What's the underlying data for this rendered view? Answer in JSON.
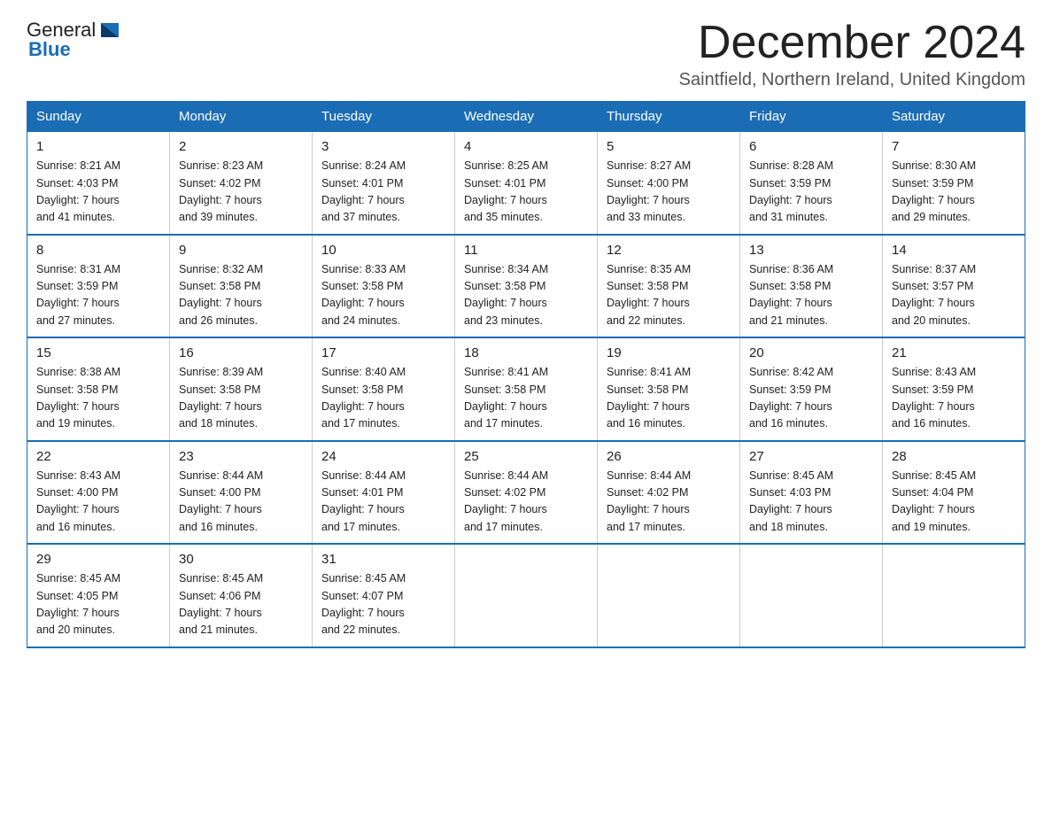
{
  "header": {
    "logo_text_general": "General",
    "logo_text_blue": "Blue",
    "month_title": "December 2024",
    "location": "Saintfield, Northern Ireland, United Kingdom"
  },
  "days_of_week": [
    "Sunday",
    "Monday",
    "Tuesday",
    "Wednesday",
    "Thursday",
    "Friday",
    "Saturday"
  ],
  "weeks": [
    [
      {
        "day": "1",
        "sunrise": "8:21 AM",
        "sunset": "4:03 PM",
        "daylight": "7 hours and 41 minutes."
      },
      {
        "day": "2",
        "sunrise": "8:23 AM",
        "sunset": "4:02 PM",
        "daylight": "7 hours and 39 minutes."
      },
      {
        "day": "3",
        "sunrise": "8:24 AM",
        "sunset": "4:01 PM",
        "daylight": "7 hours and 37 minutes."
      },
      {
        "day": "4",
        "sunrise": "8:25 AM",
        "sunset": "4:01 PM",
        "daylight": "7 hours and 35 minutes."
      },
      {
        "day": "5",
        "sunrise": "8:27 AM",
        "sunset": "4:00 PM",
        "daylight": "7 hours and 33 minutes."
      },
      {
        "day": "6",
        "sunrise": "8:28 AM",
        "sunset": "3:59 PM",
        "daylight": "7 hours and 31 minutes."
      },
      {
        "day": "7",
        "sunrise": "8:30 AM",
        "sunset": "3:59 PM",
        "daylight": "7 hours and 29 minutes."
      }
    ],
    [
      {
        "day": "8",
        "sunrise": "8:31 AM",
        "sunset": "3:59 PM",
        "daylight": "7 hours and 27 minutes."
      },
      {
        "day": "9",
        "sunrise": "8:32 AM",
        "sunset": "3:58 PM",
        "daylight": "7 hours and 26 minutes."
      },
      {
        "day": "10",
        "sunrise": "8:33 AM",
        "sunset": "3:58 PM",
        "daylight": "7 hours and 24 minutes."
      },
      {
        "day": "11",
        "sunrise": "8:34 AM",
        "sunset": "3:58 PM",
        "daylight": "7 hours and 23 minutes."
      },
      {
        "day": "12",
        "sunrise": "8:35 AM",
        "sunset": "3:58 PM",
        "daylight": "7 hours and 22 minutes."
      },
      {
        "day": "13",
        "sunrise": "8:36 AM",
        "sunset": "3:58 PM",
        "daylight": "7 hours and 21 minutes."
      },
      {
        "day": "14",
        "sunrise": "8:37 AM",
        "sunset": "3:57 PM",
        "daylight": "7 hours and 20 minutes."
      }
    ],
    [
      {
        "day": "15",
        "sunrise": "8:38 AM",
        "sunset": "3:58 PM",
        "daylight": "7 hours and 19 minutes."
      },
      {
        "day": "16",
        "sunrise": "8:39 AM",
        "sunset": "3:58 PM",
        "daylight": "7 hours and 18 minutes."
      },
      {
        "day": "17",
        "sunrise": "8:40 AM",
        "sunset": "3:58 PM",
        "daylight": "7 hours and 17 minutes."
      },
      {
        "day": "18",
        "sunrise": "8:41 AM",
        "sunset": "3:58 PM",
        "daylight": "7 hours and 17 minutes."
      },
      {
        "day": "19",
        "sunrise": "8:41 AM",
        "sunset": "3:58 PM",
        "daylight": "7 hours and 16 minutes."
      },
      {
        "day": "20",
        "sunrise": "8:42 AM",
        "sunset": "3:59 PM",
        "daylight": "7 hours and 16 minutes."
      },
      {
        "day": "21",
        "sunrise": "8:43 AM",
        "sunset": "3:59 PM",
        "daylight": "7 hours and 16 minutes."
      }
    ],
    [
      {
        "day": "22",
        "sunrise": "8:43 AM",
        "sunset": "4:00 PM",
        "daylight": "7 hours and 16 minutes."
      },
      {
        "day": "23",
        "sunrise": "8:44 AM",
        "sunset": "4:00 PM",
        "daylight": "7 hours and 16 minutes."
      },
      {
        "day": "24",
        "sunrise": "8:44 AM",
        "sunset": "4:01 PM",
        "daylight": "7 hours and 17 minutes."
      },
      {
        "day": "25",
        "sunrise": "8:44 AM",
        "sunset": "4:02 PM",
        "daylight": "7 hours and 17 minutes."
      },
      {
        "day": "26",
        "sunrise": "8:44 AM",
        "sunset": "4:02 PM",
        "daylight": "7 hours and 17 minutes."
      },
      {
        "day": "27",
        "sunrise": "8:45 AM",
        "sunset": "4:03 PM",
        "daylight": "7 hours and 18 minutes."
      },
      {
        "day": "28",
        "sunrise": "8:45 AM",
        "sunset": "4:04 PM",
        "daylight": "7 hours and 19 minutes."
      }
    ],
    [
      {
        "day": "29",
        "sunrise": "8:45 AM",
        "sunset": "4:05 PM",
        "daylight": "7 hours and 20 minutes."
      },
      {
        "day": "30",
        "sunrise": "8:45 AM",
        "sunset": "4:06 PM",
        "daylight": "7 hours and 21 minutes."
      },
      {
        "day": "31",
        "sunrise": "8:45 AM",
        "sunset": "4:07 PM",
        "daylight": "7 hours and 22 minutes."
      },
      null,
      null,
      null,
      null
    ]
  ],
  "labels": {
    "sunrise": "Sunrise:",
    "sunset": "Sunset:",
    "daylight": "Daylight:"
  }
}
